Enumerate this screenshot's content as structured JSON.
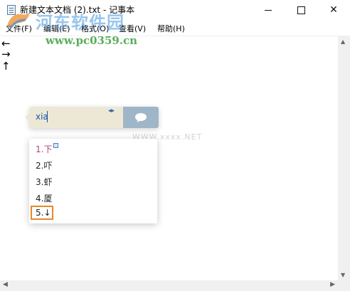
{
  "window": {
    "title": "新建文本文档 (2).txt - 记事本",
    "close_glyph": "✕"
  },
  "menu": [
    "文件(F)",
    "编辑(E)",
    "格式(O)",
    "查看(V)",
    "帮助(H)"
  ],
  "editor": {
    "lines": [
      "←",
      "→",
      "↑"
    ]
  },
  "watermark": {
    "title": "河东软件园",
    "url": "www.pc0359.cn",
    "faint_text": "WWW.xxxx.NET"
  },
  "ime": {
    "input": "xia",
    "prev_next": "◂▸",
    "candidates": [
      "1.下",
      "2.吓",
      "3.虾",
      "4.厦",
      "5.↓"
    ],
    "highlighted_index": 4
  },
  "colors": {
    "ime_bar": "#ede8d6",
    "ime_panel": "#9fb6c8",
    "highlight_border": "#e5882b",
    "first_candidate": "#b0407a"
  }
}
